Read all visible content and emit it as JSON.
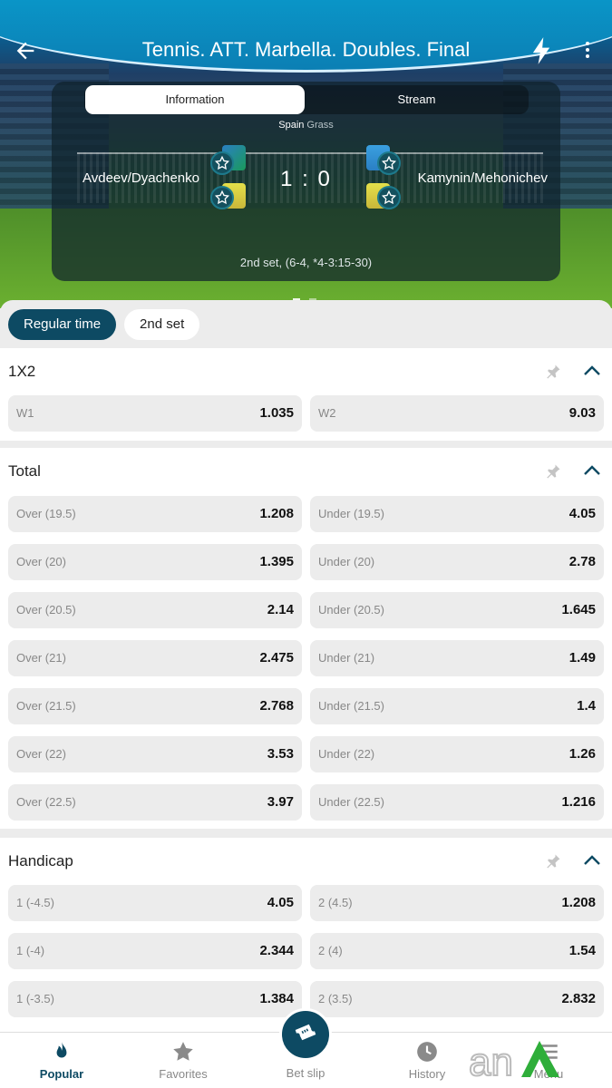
{
  "header": {
    "title": "Tennis. ATT. Marbella. Doubles. Final"
  },
  "info_card": {
    "tabs": [
      {
        "label": "Information",
        "active": true
      },
      {
        "label": "Stream",
        "active": false
      }
    ],
    "country": "Spain",
    "surface": "Grass",
    "team_left": "Avdeev/Dyachenko",
    "team_right": "Kamynin/Mehonichev",
    "score": "1 : 0",
    "set_info": "2nd set, (6-4, *4-3:15-30)"
  },
  "filters": [
    {
      "label": "Regular time",
      "active": true
    },
    {
      "label": "2nd set",
      "active": false
    }
  ],
  "markets": [
    {
      "title": "1X2",
      "odds": [
        {
          "label": "W1",
          "value": "1.035"
        },
        {
          "label": "W2",
          "value": "9.03"
        }
      ]
    },
    {
      "title": "Total",
      "odds": [
        {
          "label": "Over (19.5)",
          "value": "1.208"
        },
        {
          "label": "Under (19.5)",
          "value": "4.05"
        },
        {
          "label": "Over (20)",
          "value": "1.395"
        },
        {
          "label": "Under (20)",
          "value": "2.78"
        },
        {
          "label": "Over (20.5)",
          "value": "2.14"
        },
        {
          "label": "Under (20.5)",
          "value": "1.645"
        },
        {
          "label": "Over (21)",
          "value": "2.475"
        },
        {
          "label": "Under (21)",
          "value": "1.49"
        },
        {
          "label": "Over (21.5)",
          "value": "2.768"
        },
        {
          "label": "Under (21.5)",
          "value": "1.4"
        },
        {
          "label": "Over (22)",
          "value": "3.53"
        },
        {
          "label": "Under (22)",
          "value": "1.26"
        },
        {
          "label": "Over (22.5)",
          "value": "3.97"
        },
        {
          "label": "Under (22.5)",
          "value": "1.216"
        }
      ]
    },
    {
      "title": "Handicap",
      "odds": [
        {
          "label": "1 (-4.5)",
          "value": "4.05"
        },
        {
          "label": "2 (4.5)",
          "value": "1.208"
        },
        {
          "label": "1 (-4)",
          "value": "2.344"
        },
        {
          "label": "2 (4)",
          "value": "1.54"
        },
        {
          "label": "1 (-3.5)",
          "value": "1.384"
        },
        {
          "label": "2 (3.5)",
          "value": "2.832"
        }
      ]
    }
  ],
  "bottom_nav": [
    {
      "label": "Popular",
      "icon": "flame-icon",
      "active": true
    },
    {
      "label": "Favorites",
      "icon": "star-icon",
      "active": false
    },
    {
      "label": "Bet slip",
      "icon": "ticket-icon",
      "active": false
    },
    {
      "label": "History",
      "icon": "clock-icon",
      "active": false
    },
    {
      "label": "Menu",
      "icon": "menu-icon",
      "active": false
    }
  ],
  "colors": {
    "primary": "#0d4a63",
    "hero_top": "#0a7fb8"
  }
}
